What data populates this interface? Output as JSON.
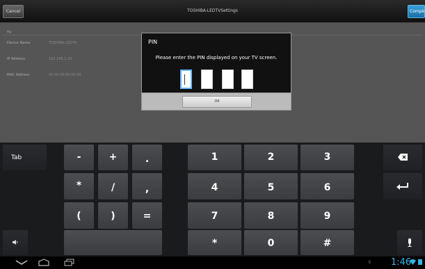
{
  "titlebar": {
    "cancel_label": "Cancel",
    "title": "TOSHIBA-LEDTVSettings",
    "complete_label": "Complete"
  },
  "settings": {
    "section": "TV",
    "rows": [
      {
        "label": "Device Name",
        "value": "TOSHIBA-LEDTV"
      },
      {
        "label": "IP Address",
        "value": "192.168.1.20"
      },
      {
        "label": "MAC Address",
        "value": "00:00:00:00:00:00"
      }
    ]
  },
  "dialog": {
    "title": "PIN",
    "message": "Please enter the PIN displayed on your TV screen.",
    "pin_digits": [
      "",
      "",
      "",
      ""
    ],
    "ok_label": "OK"
  },
  "keyboard": {
    "tab": "Tab",
    "symbols": [
      "-",
      "+",
      ".",
      "*",
      "/",
      ",",
      "(",
      ")",
      "="
    ],
    "digits": [
      "1",
      "2",
      "3",
      "4",
      "5",
      "6",
      "7",
      "8",
      "9",
      "*",
      "0",
      "#"
    ],
    "icons": {
      "backspace": "backspace-icon",
      "enter": "enter-icon",
      "settings": "keyboard-settings-icon",
      "mic": "microphone-icon"
    }
  },
  "navbar": {
    "clock": "1:46",
    "icons": [
      "back-icon",
      "home-icon",
      "recent-apps-icon"
    ]
  },
  "colors": {
    "accent": "#33b5e5",
    "complete_button": "#1a6fa6",
    "key": "#434548",
    "keyboard_bg": "#1a1b1d"
  }
}
